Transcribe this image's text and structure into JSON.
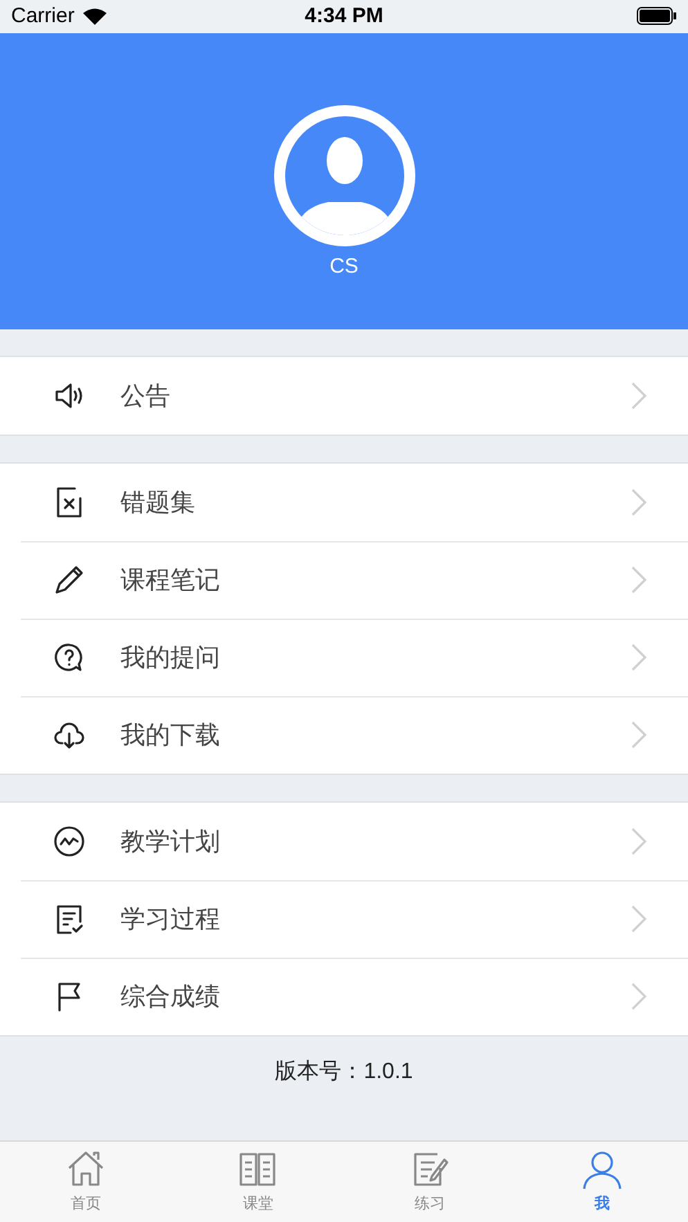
{
  "status_bar": {
    "carrier": "Carrier",
    "time": "4:34 PM"
  },
  "profile": {
    "name": "CS"
  },
  "groups": [
    [
      {
        "kind": "speaker",
        "label": "公告"
      }
    ],
    [
      {
        "kind": "wrong",
        "label": "错题集"
      },
      {
        "kind": "pencil",
        "label": "课程笔记"
      },
      {
        "kind": "question",
        "label": "我的提问"
      },
      {
        "kind": "download",
        "label": "我的下载"
      }
    ],
    [
      {
        "kind": "plan",
        "label": "教学计划"
      },
      {
        "kind": "process",
        "label": "学习过程"
      },
      {
        "kind": "flag",
        "label": "综合成绩"
      }
    ]
  ],
  "version": "版本号：1.0.1",
  "tab_bar": [
    {
      "kind": "home",
      "label": "首页",
      "selected": false
    },
    {
      "kind": "book",
      "label": "课堂",
      "selected": false
    },
    {
      "kind": "note",
      "label": "练习",
      "selected": false
    },
    {
      "kind": "person",
      "label": "我",
      "selected": true
    }
  ]
}
